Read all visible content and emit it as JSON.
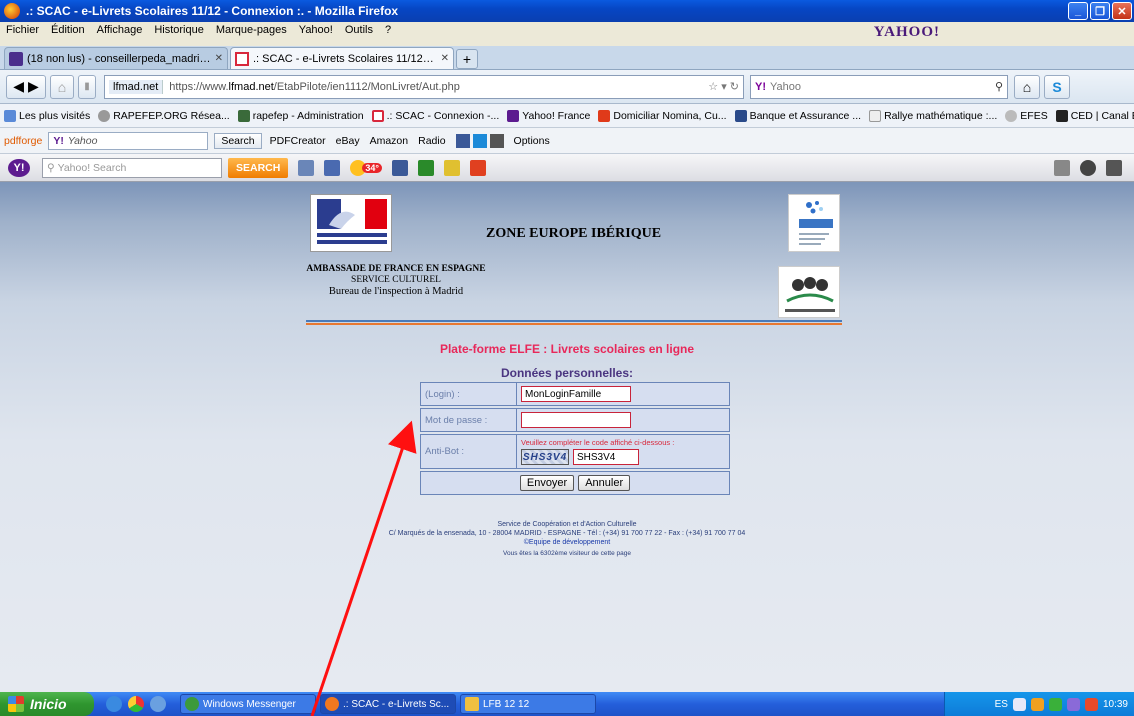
{
  "window": {
    "title": ".: SCAC - e-Livrets Scolaires 11/12 - Connexion :. - Mozilla Firefox"
  },
  "menu": [
    "Fichier",
    "Édition",
    "Affichage",
    "Historique",
    "Marque-pages",
    "Yahoo!",
    "Outils",
    "?"
  ],
  "yahoo_brand": "YAHOO!",
  "tabs": [
    {
      "label": "(18 non lus) - conseillerpeda_madrid - Ya...",
      "active": false
    },
    {
      "label": ".: SCAC - e-Livrets Scolaires 11/12 - Con...",
      "active": true
    }
  ],
  "nav": {
    "site": "lfmad.net",
    "url_prefix": "https://www.",
    "url_domain": "lfmad.net",
    "url_path": "/EtabPilote/ien1112/MonLivret/Aut.php",
    "search_placeholder": "Yahoo"
  },
  "bookmarks": [
    "Les plus visités",
    "RAPEFEP.ORG Résea...",
    "rapefep - Administration",
    ".: SCAC - Connexion -...",
    "Yahoo! France",
    "Domiciliar Nomina, Cu...",
    "Banque et Assurance ...",
    "Rallye mathématique :...",
    "EFES",
    "CED | Canal Educatif ..."
  ],
  "pdfbar": {
    "brand": "pdfforge",
    "search_value": "Yahoo",
    "search_button": "Search",
    "items": [
      "PDFCreator",
      "eBay",
      "Amazon",
      "Radio",
      "Options"
    ]
  },
  "ybar": {
    "placeholder": "Yahoo! Search",
    "button": "SEARCH",
    "badge": "34°"
  },
  "page": {
    "zone_title": "ZONE EUROPE IBÉRIQUE",
    "ambassade": "AMBASSADE DE FRANCE EN ESPAGNE",
    "service": "SERVICE CULTUREL",
    "bureau": "Bureau de l'inspection à Madrid",
    "platform": "Plate-forme ELFE : Livrets scolaires en ligne",
    "donnees": "Données personnelles:",
    "form": {
      "login_label": "(Login) :",
      "login_value": "MonLoginFamille",
      "password_label": "Mot de passe :",
      "password_value": "",
      "antibot_label": "Anti-Bot :",
      "antibot_hint": "Veuillez compléter le code affiché ci-dessous :",
      "captcha_text": "SHS3V4",
      "captcha_value": "SHS3V4",
      "submit": "Envoyer",
      "cancel": "Annuler"
    },
    "footer_line1": "Service de Coopération et d'Action Culturelle",
    "footer_line2": "C/ Marqués de la ensenada, 10 - 28004 MADRID - ESPAGNE - Tél : (+34) 91 700 77 22 - Fax : (+34) 91 700 77 04",
    "footer_line3": "©Equipe de développement",
    "visits": "Vous êtes la 6302ème visiteur de cette page"
  },
  "taskbar": {
    "start": "Inicio",
    "buttons": [
      "Windows Messenger",
      ".: SCAC - e-Livrets Sc...",
      "LFB 12 12"
    ],
    "lang": "ES",
    "clock": "10:39"
  },
  "colors": {
    "arrow": "#ff1010",
    "platform_title": "#e8285a",
    "section_title": "#4a3580"
  }
}
